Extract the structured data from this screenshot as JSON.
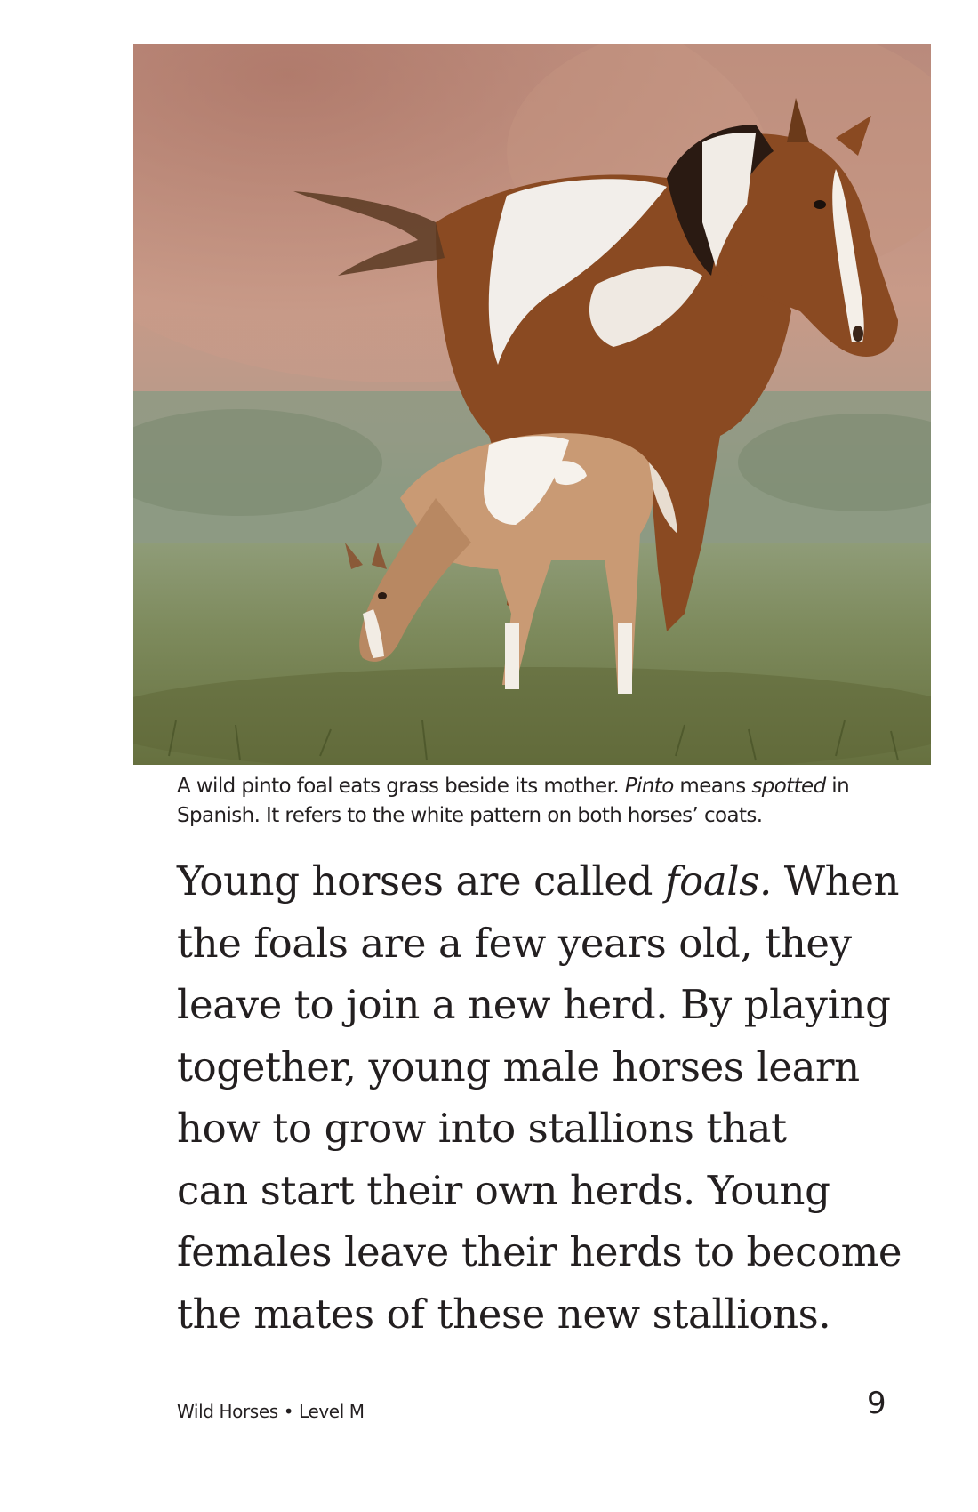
{
  "photo": {
    "subject": "wild pinto mare and foal grazing"
  },
  "caption": {
    "part1": "A wild pinto foal eats grass beside its mother. ",
    "italic1": "Pinto",
    "part2": " means ",
    "italic2": "spotted",
    "part3": " in Spanish. It refers to the white pattern on both horses’ coats."
  },
  "body": {
    "line1_a": "Young horses are called ",
    "line1_italic": "foals.",
    "line1_b": " When",
    "line2": "the foals are a few years old, they",
    "line3": "leave to join a new herd. By playing",
    "line4": "together, young male horses learn",
    "line5": "how to grow into stallions that",
    "line6": "can start their own herds. Young",
    "line7": "females leave their herds to become",
    "line8": "the mates of these new stallions."
  },
  "footer": {
    "book_title": "Wild Horses • Level M",
    "page_number": "9"
  }
}
